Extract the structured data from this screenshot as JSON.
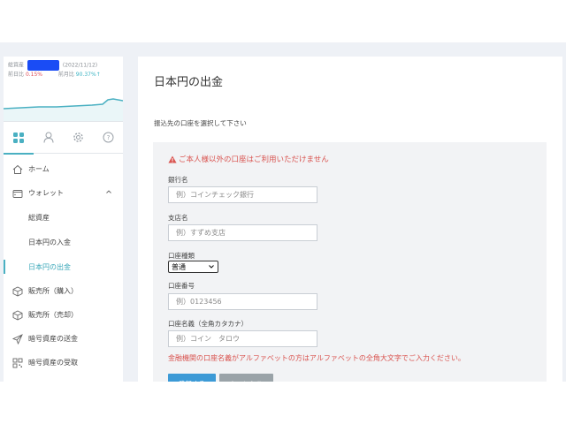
{
  "sidebar": {
    "asset": {
      "label": "総資産",
      "date": "(2022/11/12)",
      "day_label": "前日比",
      "day_value": "0.15%",
      "month_label": "前月比",
      "month_value": "90.37%↑"
    },
    "tabs": [
      "home-grid-icon",
      "user-icon",
      "gear-icon",
      "help-icon"
    ],
    "nav": {
      "home": "ホーム",
      "wallet": "ウォレット",
      "sub": [
        "総資産",
        "日本円の入金",
        "日本円の出金"
      ],
      "buy": "販売所（購入）",
      "sell": "販売所（売却）",
      "send": "暗号資産の送金",
      "receive": "暗号資産の受取"
    }
  },
  "main": {
    "title": "日本円の出金",
    "subtitle": "振込先の口座を選択して下さい",
    "warning": "ご本人様以外の口座はご利用いただけません",
    "bank_label": "銀行名",
    "bank_placeholder": "例）コインチェック銀行",
    "branch_label": "支店名",
    "branch_placeholder": "例）すずめ支店",
    "type_label": "口座種類",
    "type_value": "普通",
    "number_label": "口座番号",
    "number_placeholder": "例）0123456",
    "holder_label": "口座名義（全角カタカナ）",
    "holder_placeholder": "例）コイン　タロウ",
    "note": "金融機関の口座名義がアルファベットの方はアルファベットの全角大文字でご入力ください。",
    "submit": "登録する",
    "cancel": "キャンセル"
  },
  "colors": {
    "accent": "#4ab0c2",
    "warning": "#d9534f",
    "primary_button": "#3c9ad6",
    "secondary_button": "#9aa3a8",
    "redaction": "#1a4cf5"
  }
}
